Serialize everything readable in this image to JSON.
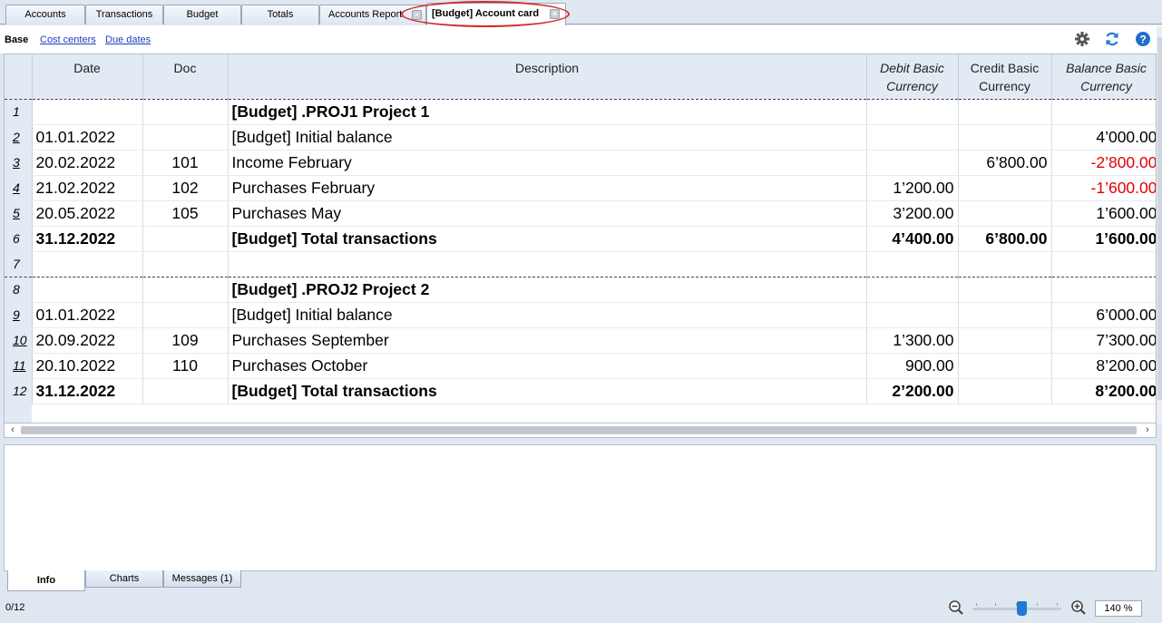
{
  "tabs": [
    {
      "label": "Accounts",
      "closable": false
    },
    {
      "label": "Transactions",
      "closable": false
    },
    {
      "label": "Budget",
      "closable": false
    },
    {
      "label": "Totals",
      "closable": false
    },
    {
      "label": "Accounts Report",
      "closable": true
    },
    {
      "label": "[Budget] Account card",
      "closable": true,
      "active": true
    }
  ],
  "subtabs": {
    "base": "Base",
    "cost_centers": "Cost centers",
    "due_dates": "Due dates"
  },
  "toolbar_icons": [
    "gear-icon",
    "refresh-icon",
    "help-icon"
  ],
  "columns": {
    "date": "Date",
    "doc": "Doc",
    "description": "Description",
    "debit": "Debit Basic Currency",
    "credit": "Credit Basic Currency",
    "balance": "Balance Basic Currency"
  },
  "rows": [
    {
      "n": "1",
      "date": "",
      "doc": "",
      "desc": "[Budget] .PROJ1 Project 1",
      "debit": "",
      "credit": "",
      "balance": ""
    },
    {
      "n": "2",
      "date": "01.01.2022",
      "doc": "",
      "desc": "[Budget] Initial balance",
      "debit": "",
      "credit": "",
      "balance": "4’000.00"
    },
    {
      "n": "3",
      "date": "20.02.2022",
      "doc": "101",
      "desc": "Income February",
      "debit": "",
      "credit": "6’800.00",
      "balance": "-2’800.00"
    },
    {
      "n": "4",
      "date": "21.02.2022",
      "doc": "102",
      "desc": "Purchases February",
      "debit": "1’200.00",
      "credit": "",
      "balance": "-1’600.00"
    },
    {
      "n": "5",
      "date": "20.05.2022",
      "doc": "105",
      "desc": "Purchases May",
      "debit": "3’200.00",
      "credit": "",
      "balance": "1’600.00"
    },
    {
      "n": "6",
      "date": "31.12.2022",
      "doc": "",
      "desc": "[Budget] Total transactions",
      "debit": "4’400.00",
      "credit": "6’800.00",
      "balance": "1’600.00"
    },
    {
      "n": "7",
      "date": "",
      "doc": "",
      "desc": "",
      "debit": "",
      "credit": "",
      "balance": ""
    },
    {
      "n": "8",
      "date": "",
      "doc": "",
      "desc": "[Budget] .PROJ2 Project 2",
      "debit": "",
      "credit": "",
      "balance": ""
    },
    {
      "n": "9",
      "date": "01.01.2022",
      "doc": "",
      "desc": "[Budget] Initial balance",
      "debit": "",
      "credit": "",
      "balance": "6’000.00"
    },
    {
      "n": "10",
      "date": "20.09.2022",
      "doc": "109",
      "desc": "Purchases September",
      "debit": "1’300.00",
      "credit": "",
      "balance": "7’300.00"
    },
    {
      "n": "11",
      "date": "20.10.2022",
      "doc": "110",
      "desc": "Purchases October",
      "debit": "900.00",
      "credit": "",
      "balance": "8’200.00"
    },
    {
      "n": "12",
      "date": "31.12.2022",
      "doc": "",
      "desc": "[Budget] Total transactions",
      "debit": "2’200.00",
      "credit": "",
      "balance": "8’200.00"
    }
  ],
  "bottom_tabs": {
    "info": "Info",
    "charts": "Charts",
    "messages": "Messages (1)"
  },
  "status": {
    "row_count": "0/12",
    "zoom": "140 %",
    "zoom_level_fraction": 0.55
  },
  "colors": {
    "negative": "#e00000",
    "accent": "#1f7ad6",
    "highlight": "#d42a2a"
  }
}
